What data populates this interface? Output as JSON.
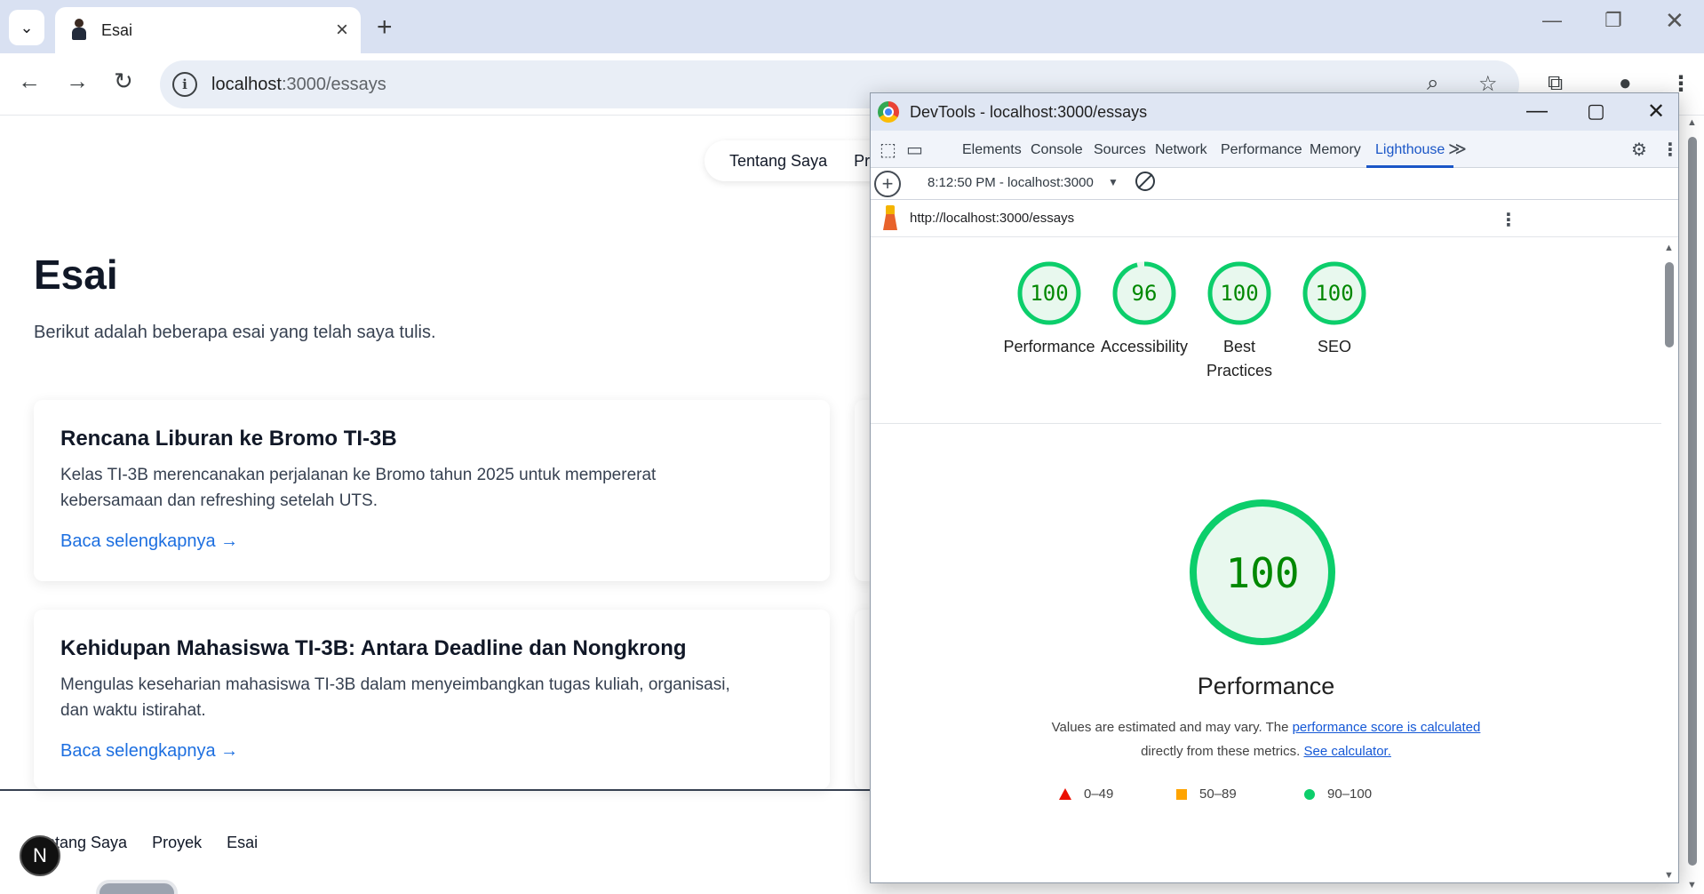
{
  "browser": {
    "tab_title": "Esai",
    "url_host": "localhost",
    "url_path": ":3000/essays",
    "icons": [
      "tab-list-chevron-icon",
      "tab-favicon-avatar",
      "close-icon",
      "new-tab-plus-icon",
      "minimize-icon",
      "restore-icon",
      "close-window-icon",
      "back-arrow-icon",
      "forward-arrow-icon",
      "reload-icon",
      "site-info-icon",
      "zoom-icon",
      "bookmark-star-icon",
      "extensions-puzzle-icon",
      "profile-avatar",
      "menu-kebab-icon"
    ]
  },
  "site": {
    "nav": [
      "Tentang Saya",
      "Pro"
    ],
    "title": "Esai",
    "subtitle": "Berikut adalah beberapa esai yang telah saya tulis.",
    "cards": [
      {
        "title": "Rencana Liburan ke Bromo TI-3B",
        "body_line1": "Kelas TI-3B merencanakan perjalanan ke Bromo tahun 2025 untuk mempererat",
        "body_line2": "kebersamaan dan refreshing setelah UTS.",
        "link": "Baca selengkapnya →"
      },
      {
        "title": "Kehidupan Mahasiswa TI-3B: Antara Deadline dan Nongkrong",
        "body_line1": "Mengulas keseharian mahasiswa TI-3B dalam menyeimbangkan tugas kuliah, organisasi,",
        "body_line2": "dan waktu istirahat.",
        "link": "Baca selengkapnya →"
      }
    ],
    "footer_links": [
      "ntang Saya",
      "Proyek",
      "Esai"
    ],
    "badge": "N"
  },
  "devtools": {
    "window_title": "DevTools - localhost:3000/essays",
    "tabs": [
      "Elements",
      "Console",
      "Sources",
      "Network",
      "Performance",
      "Memory",
      "Lighthouse"
    ],
    "active_tab": "Lighthouse",
    "overflow": "≫",
    "report_select": "8:12:50 PM - localhost:3000",
    "report_url": "http://localhost:3000/essays",
    "scores": [
      {
        "label": "Performance",
        "value": 100,
        "display": "100"
      },
      {
        "label": "Accessibility",
        "value": 96,
        "display": "96"
      },
      {
        "label": "Best Practices",
        "value": 100,
        "display": "100"
      },
      {
        "label": "SEO",
        "value": 100,
        "display": "100"
      }
    ],
    "best_practices_line1": "Best",
    "best_practices_line2": "Practices",
    "main_score": {
      "label": "Performance",
      "value": 100,
      "display": "100"
    },
    "note_part1": "Values are estimated and may vary. The ",
    "note_link1": "performance score is calculated",
    "note_part2": "directly from these metrics. ",
    "note_link2": "See calculator.",
    "legend": [
      {
        "range": "0–49",
        "color": "#eb0f00"
      },
      {
        "range": "50–89",
        "color": "#ffa400"
      },
      {
        "range": "90–100",
        "color": "#0cce6b"
      }
    ],
    "colors": {
      "pass_ring": "#0cce6b",
      "pass_fill": "#e8f8ee",
      "pass_text": "#008800",
      "active_tab": "#1a56c7"
    }
  }
}
